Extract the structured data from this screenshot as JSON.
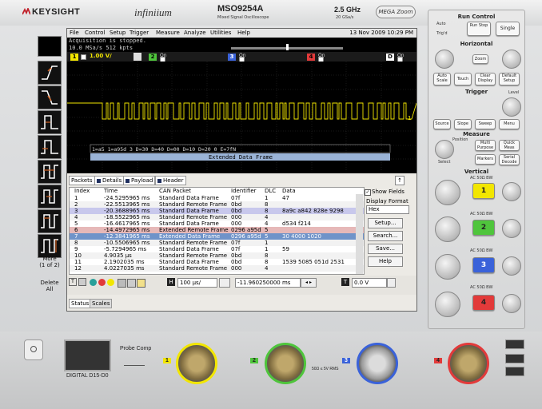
{
  "instrument": {
    "brand": "KEYSIGHT",
    "series": "infiniium",
    "model": "MSO9254A",
    "model_sub": "Mixed Signal Oscilloscope",
    "bandwidth": "2.5 GHz",
    "sample_rate": "20 GSa/s",
    "megazoom": "MEGA Zoom"
  },
  "menu": {
    "items": [
      "File",
      "Control",
      "Setup",
      "Trigger",
      "Measure",
      "Analyze",
      "Utilities",
      "Help"
    ],
    "date": "13 Nov 2009 10:29 PM"
  },
  "status": {
    "line1": "Acquisition is stopped.",
    "line2": "10.0 MSa/s   512 kpts"
  },
  "channels": {
    "ch1_scale": "1.00 V/",
    "on_label": "On",
    "ch2": "2",
    "ch3": "3",
    "ch4": "4",
    "digital": "D",
    "ch1": "1"
  },
  "decode": {
    "bus_text": "1=a5 1=a95d 3 D=30 D=40 D=00 D=10 D=20 0 E=7fN",
    "frame_label": "Extended Data Frame",
    "right_marker": "1"
  },
  "tabs": [
    "Packets",
    "Details",
    "Payload",
    "Header"
  ],
  "table": {
    "headers": [
      "Index",
      "Time",
      "CAN Packet",
      "Identifier",
      "DLC",
      "Data"
    ],
    "rows": [
      [
        "1",
        "-24.5295965 ms",
        "Standard Data Frame",
        "07f",
        "1",
        "47"
      ],
      [
        "2",
        "-22.5513965 ms",
        "Standard Remote Frame",
        "0bd",
        "8",
        ""
      ],
      [
        "3",
        "-20.3688965 ms",
        "Standard Data Frame",
        "0bd",
        "8",
        "8a9c a842 828e 9298"
      ],
      [
        "4",
        "-18.5522965 ms",
        "Standard Remote Frame",
        "000",
        "4",
        ""
      ],
      [
        "5",
        "-16.4617965 ms",
        "Standard Data Frame",
        "000",
        "4",
        "d534 f214"
      ],
      [
        "6",
        "-14.4972965 ms",
        "Extended Remote Frame",
        "0296 a95d",
        "5",
        ""
      ],
      [
        "7",
        "-12.3841965 ms",
        "Extended Data Frame",
        "0296 a95d",
        "5",
        "30 4000 1020"
      ],
      [
        "8",
        "-10.5506965 ms",
        "Standard Remote Frame",
        "07f",
        "1",
        ""
      ],
      [
        "9",
        "-5.7294965 ms",
        "Standard Data Frame",
        "07f",
        "1",
        "59"
      ],
      [
        "10",
        "4.9035 µs",
        "Standard Remote Frame",
        "0bd",
        "8",
        ""
      ],
      [
        "11",
        "2.1902035 ms",
        "Standard Data Frame",
        "0bd",
        "8",
        "1539 5085 051d 2531"
      ],
      [
        "12",
        "4.0227035 ms",
        "Standard Remote Frame",
        "000",
        "4",
        ""
      ]
    ]
  },
  "options": {
    "show_fields": "Show Fields",
    "display_format": "Display Format",
    "format_value": "Hex",
    "buttons": [
      "Setup...",
      "Search...",
      "Save...",
      "Help"
    ]
  },
  "toolbar": {
    "timebase": "100 µs/",
    "position": "-11.960250000 ms",
    "trigger_channel": "T",
    "trigger_level": "0.0 V",
    "h_label": "H"
  },
  "bottom_tabs": [
    "Status",
    "Scales"
  ],
  "left_panel": {
    "more": "More",
    "more_sub": "(1 of 2)",
    "delete": "Delete",
    "delete_sub": "All"
  },
  "control_panel": {
    "run_control": "Run Control",
    "auto": "Auto",
    "trig_d": "Trig'd",
    "run_stop": "Run Stop",
    "single": "Single",
    "horizontal": "Horizontal",
    "zoom": "Zoom",
    "push": "Push",
    "auto_scale": "Auto Scale",
    "touch": "Touch",
    "clear_display": "Clear Display",
    "default_setup": "Default Setup",
    "trigger": "Trigger",
    "level": "Level",
    "source": "Source",
    "slope": "Slope",
    "sweep": "Sweep",
    "menu": "Menu",
    "measure": "Measure",
    "position_label": "Position",
    "multi_purpose": "Multi Purpose",
    "quick_meas": "Quick Meas",
    "select": "Select",
    "markers": "Markers",
    "serial_decode": "Serial Decode",
    "vertical": "Vertical",
    "bw_label": "AC 50Ω BW",
    "channel_buttons": [
      "1",
      "2",
      "3",
      "4"
    ]
  },
  "front": {
    "digital": "DIGITAL D15-D0",
    "probe_comp": "Probe Comp",
    "bnc_labels": [
      "1",
      "2",
      "3",
      "4"
    ],
    "spec": "50Ω ≤ 5V RMS"
  },
  "colors": {
    "ch1": "#f2e600",
    "ch2": "#4fc53c",
    "ch3": "#3a62d9",
    "ch4": "#e23a3a",
    "selected_row": "#6f93c9",
    "highlight_row6": "#e6b8b8",
    "highlight_row3": "#c8c8ec"
  }
}
